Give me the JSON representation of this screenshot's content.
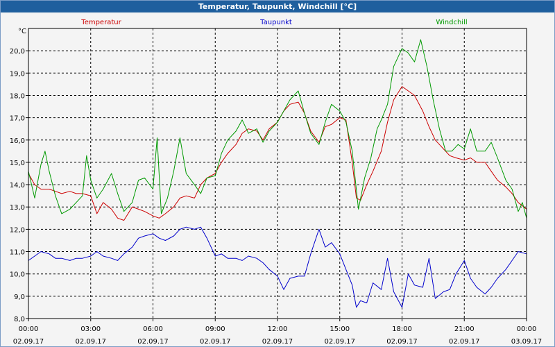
{
  "window": {
    "title": "Temperatur, Taupunkt, Windchill [°C]"
  },
  "chart_data": {
    "type": "line",
    "unit_label": "°C",
    "ylim": [
      8.0,
      21.0
    ],
    "yticks": [
      "8,0",
      "9,0",
      "10,0",
      "11,0",
      "12,0",
      "13,0",
      "14,0",
      "15,0",
      "16,0",
      "17,0",
      "18,0",
      "19,0",
      "20,0"
    ],
    "xlim_hours": [
      0,
      24
    ],
    "xticks": [
      {
        "time": "00:00",
        "date": "02.09.17"
      },
      {
        "time": "03:00",
        "date": "02.09.17"
      },
      {
        "time": "06:00",
        "date": "02.09.17"
      },
      {
        "time": "09:00",
        "date": "02.09.17"
      },
      {
        "time": "12:00",
        "date": "02.09.17"
      },
      {
        "time": "15:00",
        "date": "02.09.17"
      },
      {
        "time": "18:00",
        "date": "02.09.17"
      },
      {
        "time": "21:00",
        "date": "02.09.17"
      },
      {
        "time": "00:00",
        "date": "03.09.17"
      }
    ],
    "grid": true,
    "series": [
      {
        "name": "Temperatur",
        "color": "#cc0000",
        "points": [
          [
            0,
            14.5
          ],
          [
            0.3,
            14.0
          ],
          [
            0.6,
            13.8
          ],
          [
            1.0,
            13.8
          ],
          [
            1.3,
            13.7
          ],
          [
            1.6,
            13.6
          ],
          [
            2.0,
            13.7
          ],
          [
            2.3,
            13.6
          ],
          [
            2.6,
            13.6
          ],
          [
            3.0,
            13.5
          ],
          [
            3.3,
            12.7
          ],
          [
            3.6,
            13.2
          ],
          [
            4.0,
            12.9
          ],
          [
            4.3,
            12.5
          ],
          [
            4.6,
            12.4
          ],
          [
            5.0,
            13.0
          ],
          [
            5.3,
            12.9
          ],
          [
            5.6,
            12.8
          ],
          [
            6.0,
            12.6
          ],
          [
            6.3,
            12.5
          ],
          [
            6.6,
            12.7
          ],
          [
            7.0,
            13.0
          ],
          [
            7.3,
            13.4
          ],
          [
            7.6,
            13.5
          ],
          [
            8.0,
            13.4
          ],
          [
            8.3,
            14.0
          ],
          [
            8.6,
            14.3
          ],
          [
            9.0,
            14.5
          ],
          [
            9.3,
            15.0
          ],
          [
            9.6,
            15.4
          ],
          [
            10.0,
            15.8
          ],
          [
            10.3,
            16.3
          ],
          [
            10.6,
            16.5
          ],
          [
            11.0,
            16.4
          ],
          [
            11.3,
            16.0
          ],
          [
            11.6,
            16.5
          ],
          [
            12.0,
            16.8
          ],
          [
            12.3,
            17.3
          ],
          [
            12.6,
            17.6
          ],
          [
            13.0,
            17.7
          ],
          [
            13.3,
            17.2
          ],
          [
            13.6,
            16.4
          ],
          [
            14.0,
            15.9
          ],
          [
            14.3,
            16.6
          ],
          [
            14.6,
            16.7
          ],
          [
            15.0,
            17.0
          ],
          [
            15.3,
            16.9
          ],
          [
            15.6,
            15.0
          ],
          [
            15.8,
            13.4
          ],
          [
            16.0,
            13.3
          ],
          [
            16.3,
            14.0
          ],
          [
            16.6,
            14.6
          ],
          [
            17.0,
            15.5
          ],
          [
            17.3,
            16.8
          ],
          [
            17.6,
            17.8
          ],
          [
            18.0,
            18.4
          ],
          [
            18.3,
            18.2
          ],
          [
            18.6,
            18.0
          ],
          [
            19.0,
            17.3
          ],
          [
            19.3,
            16.6
          ],
          [
            19.6,
            16.0
          ],
          [
            20.0,
            15.6
          ],
          [
            20.3,
            15.3
          ],
          [
            20.6,
            15.2
          ],
          [
            21.0,
            15.1
          ],
          [
            21.3,
            15.2
          ],
          [
            21.6,
            15.0
          ],
          [
            22.0,
            15.0
          ],
          [
            22.3,
            14.6
          ],
          [
            22.6,
            14.2
          ],
          [
            23.0,
            13.9
          ],
          [
            23.3,
            13.6
          ],
          [
            23.6,
            13.2
          ],
          [
            24.0,
            12.9
          ]
        ]
      },
      {
        "name": "Taupunkt",
        "color": "#0000cc",
        "points": [
          [
            0,
            10.6
          ],
          [
            0.3,
            10.8
          ],
          [
            0.6,
            11.0
          ],
          [
            1.0,
            10.9
          ],
          [
            1.3,
            10.7
          ],
          [
            1.6,
            10.7
          ],
          [
            2.0,
            10.6
          ],
          [
            2.3,
            10.7
          ],
          [
            2.6,
            10.7
          ],
          [
            3.0,
            10.8
          ],
          [
            3.3,
            11.0
          ],
          [
            3.6,
            10.8
          ],
          [
            4.0,
            10.7
          ],
          [
            4.3,
            10.6
          ],
          [
            4.6,
            10.9
          ],
          [
            5.0,
            11.2
          ],
          [
            5.3,
            11.6
          ],
          [
            5.6,
            11.7
          ],
          [
            6.0,
            11.8
          ],
          [
            6.3,
            11.6
          ],
          [
            6.6,
            11.5
          ],
          [
            7.0,
            11.7
          ],
          [
            7.3,
            12.0
          ],
          [
            7.6,
            12.1
          ],
          [
            8.0,
            12.0
          ],
          [
            8.3,
            12.1
          ],
          [
            8.6,
            11.6
          ],
          [
            9.0,
            10.8
          ],
          [
            9.3,
            10.9
          ],
          [
            9.6,
            10.7
          ],
          [
            10.0,
            10.7
          ],
          [
            10.3,
            10.6
          ],
          [
            10.6,
            10.8
          ],
          [
            11.0,
            10.7
          ],
          [
            11.3,
            10.5
          ],
          [
            11.6,
            10.2
          ],
          [
            12.0,
            9.9
          ],
          [
            12.3,
            9.3
          ],
          [
            12.6,
            9.8
          ],
          [
            13.0,
            9.9
          ],
          [
            13.3,
            9.9
          ],
          [
            13.6,
            10.9
          ],
          [
            14.0,
            12.0
          ],
          [
            14.3,
            11.2
          ],
          [
            14.6,
            11.4
          ],
          [
            15.0,
            10.9
          ],
          [
            15.3,
            10.2
          ],
          [
            15.6,
            9.5
          ],
          [
            15.8,
            8.5
          ],
          [
            16.0,
            8.8
          ],
          [
            16.3,
            8.7
          ],
          [
            16.6,
            9.6
          ],
          [
            17.0,
            9.3
          ],
          [
            17.3,
            10.7
          ],
          [
            17.6,
            9.2
          ],
          [
            18.0,
            8.5
          ],
          [
            18.3,
            10.0
          ],
          [
            18.6,
            9.5
          ],
          [
            19.0,
            9.4
          ],
          [
            19.3,
            10.7
          ],
          [
            19.6,
            8.9
          ],
          [
            20.0,
            9.2
          ],
          [
            20.3,
            9.3
          ],
          [
            20.6,
            10.0
          ],
          [
            21.0,
            10.6
          ],
          [
            21.3,
            9.8
          ],
          [
            21.6,
            9.4
          ],
          [
            22.0,
            9.1
          ],
          [
            22.3,
            9.4
          ],
          [
            22.6,
            9.8
          ],
          [
            23.0,
            10.2
          ],
          [
            23.3,
            10.6
          ],
          [
            23.6,
            11.0
          ],
          [
            24.0,
            10.9
          ]
        ]
      },
      {
        "name": "Windchill",
        "color": "#009900",
        "points": [
          [
            0,
            14.6
          ],
          [
            0.3,
            13.4
          ],
          [
            0.6,
            14.9
          ],
          [
            0.8,
            15.5
          ],
          [
            1.0,
            14.6
          ],
          [
            1.3,
            13.5
          ],
          [
            1.6,
            12.7
          ],
          [
            2.0,
            12.9
          ],
          [
            2.3,
            13.2
          ],
          [
            2.6,
            13.5
          ],
          [
            2.8,
            15.3
          ],
          [
            3.0,
            14.2
          ],
          [
            3.3,
            13.4
          ],
          [
            3.6,
            13.8
          ],
          [
            4.0,
            14.5
          ],
          [
            4.3,
            13.6
          ],
          [
            4.6,
            12.8
          ],
          [
            5.0,
            13.2
          ],
          [
            5.3,
            14.2
          ],
          [
            5.6,
            14.3
          ],
          [
            6.0,
            13.8
          ],
          [
            6.2,
            16.1
          ],
          [
            6.4,
            12.7
          ],
          [
            6.7,
            13.4
          ],
          [
            7.0,
            14.6
          ],
          [
            7.3,
            16.1
          ],
          [
            7.6,
            14.5
          ],
          [
            8.0,
            14.0
          ],
          [
            8.3,
            13.6
          ],
          [
            8.6,
            14.3
          ],
          [
            9.0,
            14.4
          ],
          [
            9.3,
            15.4
          ],
          [
            9.6,
            16.0
          ],
          [
            10.0,
            16.4
          ],
          [
            10.3,
            16.9
          ],
          [
            10.6,
            16.3
          ],
          [
            11.0,
            16.5
          ],
          [
            11.3,
            15.9
          ],
          [
            11.6,
            16.4
          ],
          [
            12.0,
            16.8
          ],
          [
            12.3,
            17.3
          ],
          [
            12.6,
            17.8
          ],
          [
            13.0,
            18.2
          ],
          [
            13.3,
            17.2
          ],
          [
            13.6,
            16.3
          ],
          [
            14.0,
            15.8
          ],
          [
            14.3,
            16.8
          ],
          [
            14.6,
            17.6
          ],
          [
            15.0,
            17.3
          ],
          [
            15.3,
            16.8
          ],
          [
            15.6,
            15.5
          ],
          [
            15.9,
            12.9
          ],
          [
            16.2,
            14.3
          ],
          [
            16.5,
            15.2
          ],
          [
            16.8,
            16.5
          ],
          [
            17.0,
            16.9
          ],
          [
            17.3,
            17.6
          ],
          [
            17.6,
            19.3
          ],
          [
            18.0,
            20.1
          ],
          [
            18.3,
            19.9
          ],
          [
            18.6,
            19.5
          ],
          [
            18.9,
            20.5
          ],
          [
            19.2,
            19.3
          ],
          [
            19.5,
            17.8
          ],
          [
            19.8,
            16.5
          ],
          [
            20.1,
            15.5
          ],
          [
            20.4,
            15.5
          ],
          [
            20.7,
            15.8
          ],
          [
            21.0,
            15.6
          ],
          [
            21.3,
            16.5
          ],
          [
            21.6,
            15.5
          ],
          [
            22.0,
            15.5
          ],
          [
            22.3,
            15.9
          ],
          [
            22.6,
            15.2
          ],
          [
            23.0,
            14.2
          ],
          [
            23.3,
            13.8
          ],
          [
            23.6,
            12.8
          ],
          [
            23.8,
            13.2
          ],
          [
            24.0,
            12.5
          ]
        ]
      }
    ]
  }
}
